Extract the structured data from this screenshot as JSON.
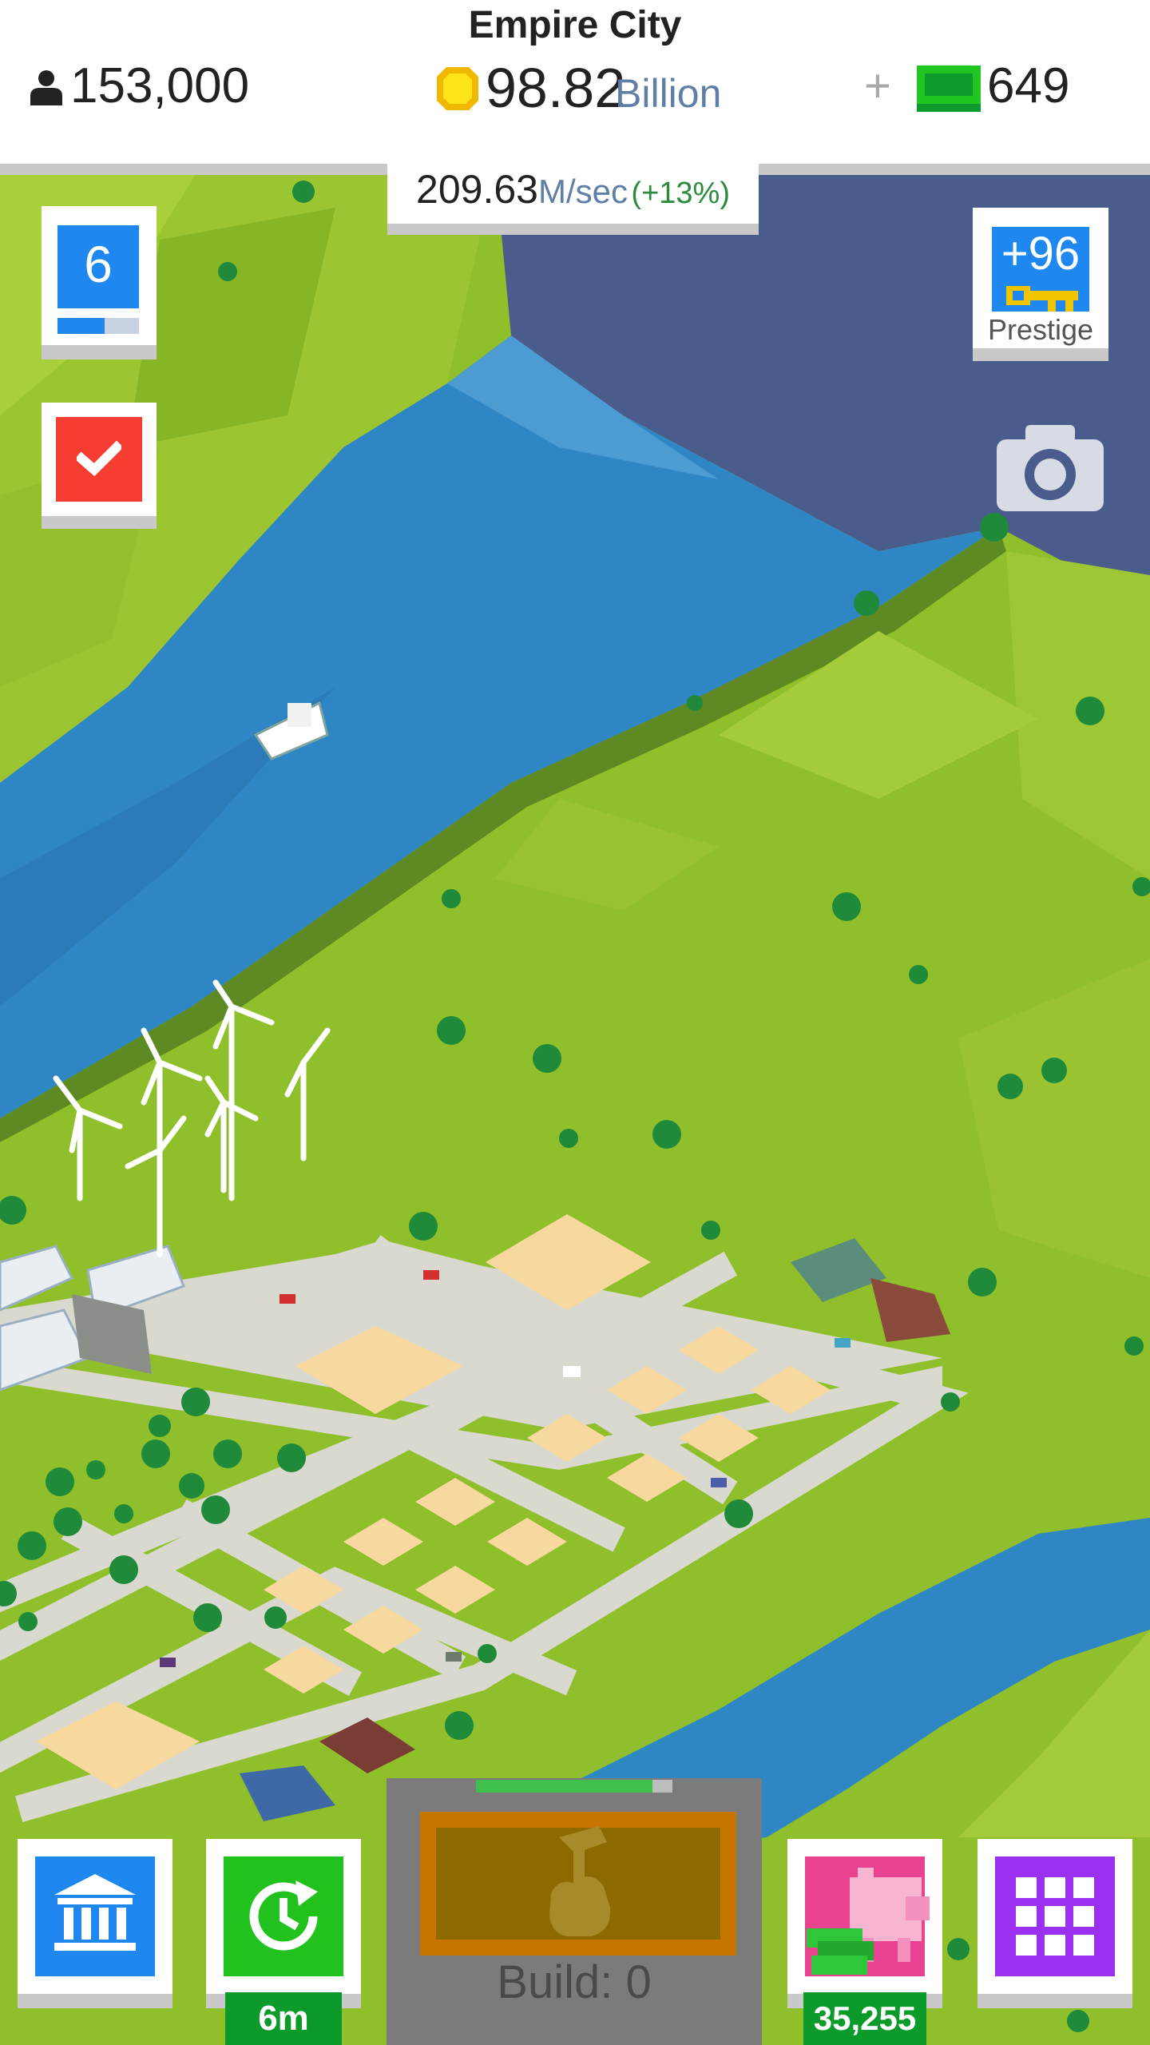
{
  "header": {
    "city_name": "Empire City",
    "population": "153,000",
    "money_amount": "98.82",
    "money_unit": "Billion",
    "plus": "+",
    "premium_cash": "649"
  },
  "income": {
    "value": "209.63",
    "unit": "M/sec",
    "bonus": "(+13%)"
  },
  "level": {
    "number": "6",
    "progress_fraction": 0.58
  },
  "prestige": {
    "value": "+96",
    "label": "Prestige"
  },
  "bottom_bar": {
    "boost_timer": "6m",
    "piggy_bank_amount": "35,255",
    "build_label": "Build: 0",
    "build_progress_fraction": 0.9
  },
  "icons": [
    "person-icon",
    "coin-icon",
    "cash-icon",
    "checkmark-icon",
    "key-icon",
    "camera-icon",
    "bank-icon",
    "clock-refresh-icon",
    "piggy-bank-icon",
    "grid-menu-icon",
    "hammer-hand-icon"
  ],
  "colors": {
    "accent_blue": "#1e88f0",
    "task_red": "#f63d32",
    "boost_green": "#22c21e",
    "piggy_pink": "#e84290",
    "menu_purple": "#9b30f0",
    "build_orange": "#c67500",
    "badge_green": "#0c9a2b",
    "water_blue": "#2f86c4",
    "grass_green": "#8fbf2a"
  }
}
